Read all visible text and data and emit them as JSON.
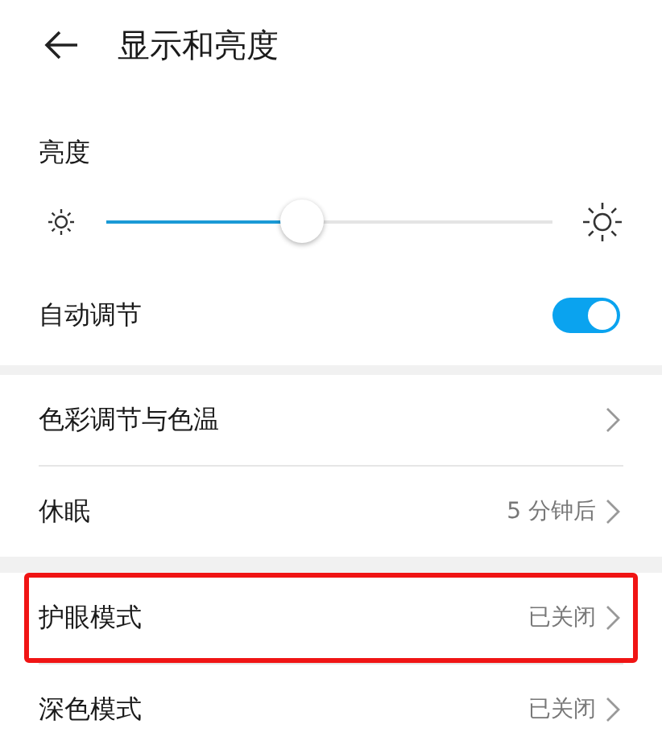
{
  "title": "显示和亮度",
  "brightness": {
    "label": "亮度",
    "level": 0.44
  },
  "auto_adjust": {
    "label": "自动调节",
    "on": true
  },
  "groups": [
    [
      {
        "label": "色彩调节与色温",
        "highlighted": false
      },
      {
        "label": "休眠",
        "value": "5 分钟后",
        "highlighted": false
      }
    ],
    [
      {
        "label": "护眼模式",
        "value": "已关闭",
        "highlighted": true
      },
      {
        "label": "深色模式",
        "value": "已关闭",
        "highlighted": false
      }
    ]
  ]
}
